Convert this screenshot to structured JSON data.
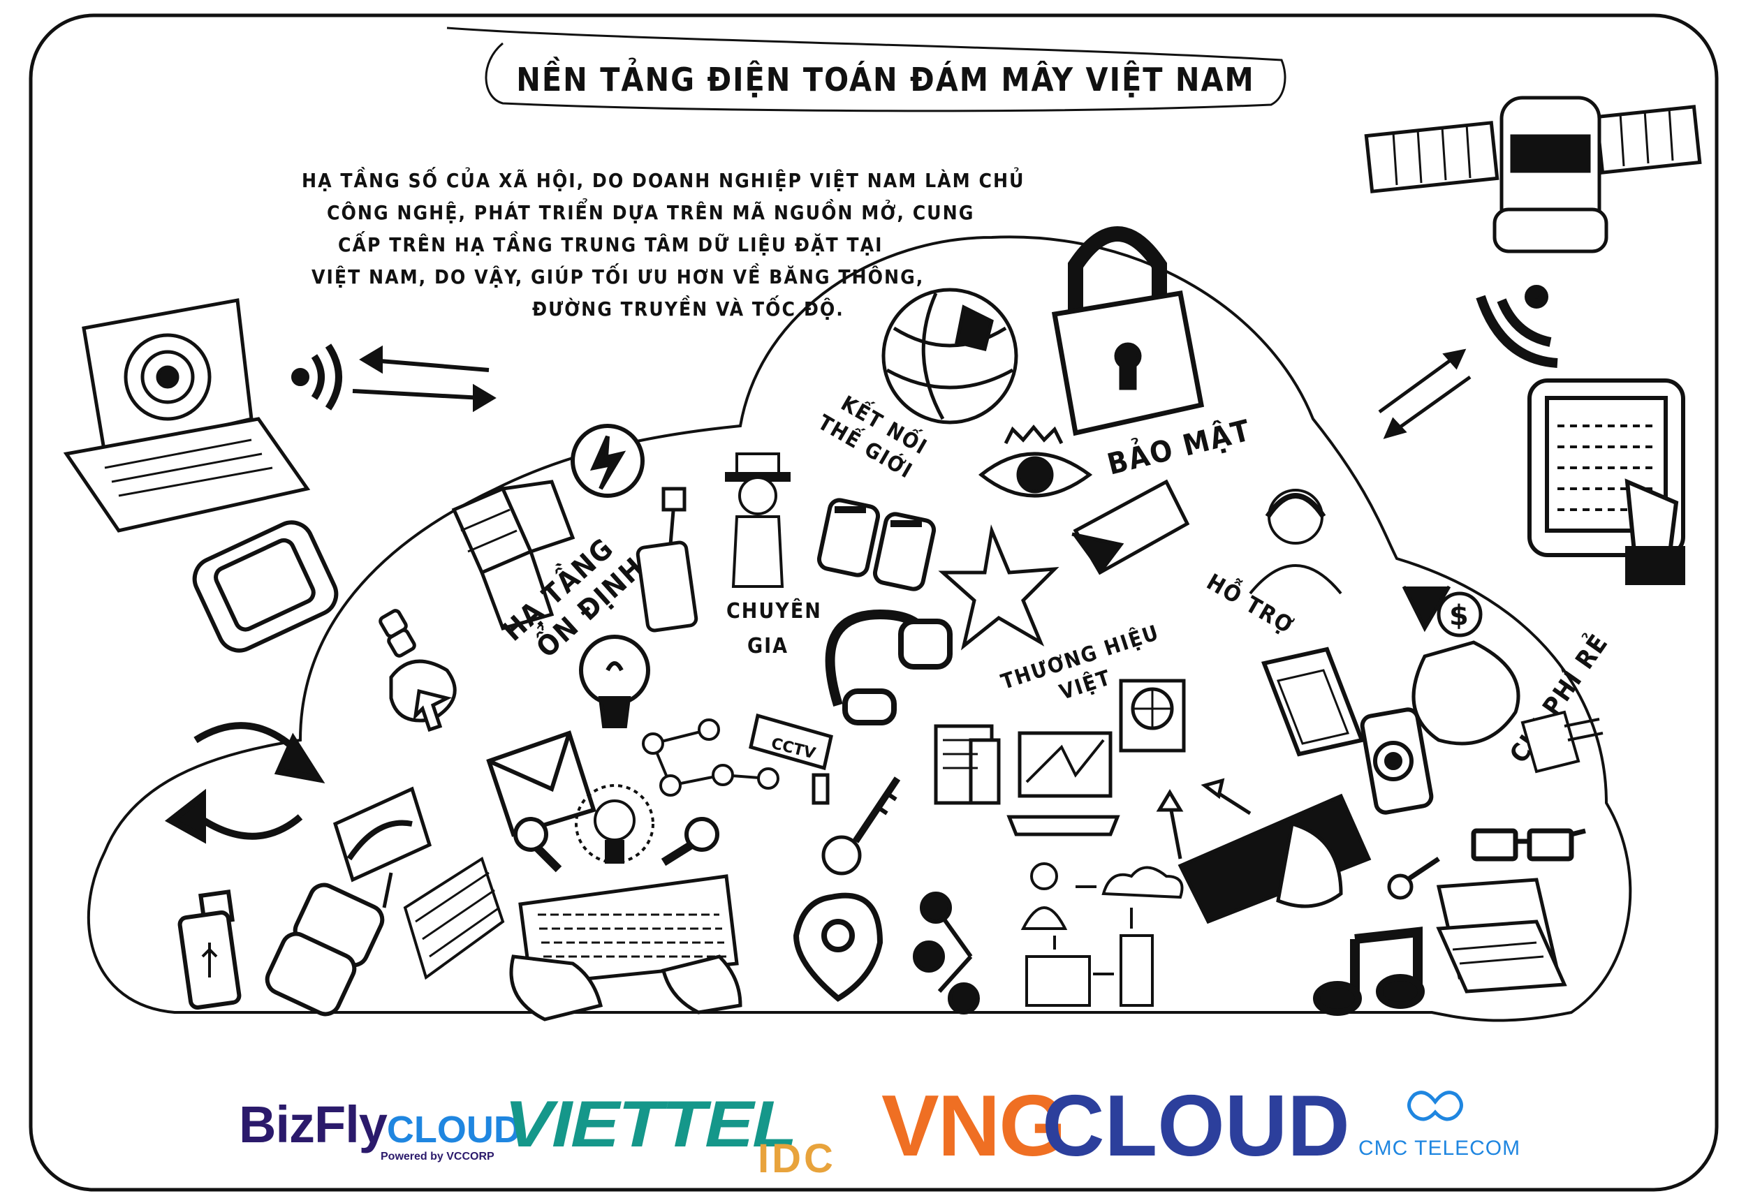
{
  "title": "NỀN TẢNG ĐIỆN TOÁN ĐÁM MÂY VIỆT NAM",
  "description_lines": [
    "HẠ TẦNG SỐ CỦA XÃ HỘI, DO DOANH NGHIỆP VIỆT NAM LÀM CHỦ",
    "CÔNG NGHỆ, PHÁT TRIỂN DỰA TRÊN MÃ NGUỒN MỞ, CUNG",
    "CẤP      TRÊN HẠ TẦNG TRUNG TÂM DỮ LIỆU ĐẶT TẠI",
    "VIỆT NAM, DO VẬY, GIÚP TỐI ƯU HƠN VỀ BĂNG THÔNG,",
    "ĐƯỜNG TRUYỀN VÀ TỐC ĐỘ."
  ],
  "labels": {
    "ket_noi": [
      "KẾT NỐI",
      "THẾ GIỚI"
    ],
    "bao_mat": "BẢO MẬT",
    "ha_tang": [
      "HẠ TẦNG",
      "ỔN ĐỊNH"
    ],
    "chuyen_gia": [
      "CHUYÊN",
      "GIA"
    ],
    "thuong_hieu": [
      "THƯƠNG HIỆU",
      "VIỆT"
    ],
    "ho_tro": "HỖ TRỢ",
    "chi_phi": "CHI PHÍ RẺ",
    "cctv": "CCTV"
  },
  "logos": {
    "bizfly_main": "BizFly",
    "bizfly_cloud": "CLOUD",
    "bizfly_sub": "Powered by VCCORP",
    "viettel": "VIETTEL",
    "viettel_idc": "IDC",
    "vng": "VNG",
    "vng_cloud": "CLOUD",
    "cmc": "CMC TELECOM"
  },
  "colors": {
    "ink": "#111111",
    "bizfly": "#2b1a6b",
    "bizfly_accent": "#1f86e0",
    "viettel": "#15978a",
    "viettel_idc": "#e8a33c",
    "vng": "#ef6f23",
    "vng_cloud": "#2c3f9c",
    "cmc": "#1f86e0"
  },
  "icons": [
    "laptop-icon",
    "wifi-icon",
    "arrows-icon",
    "satellite-icon",
    "tablet-icon",
    "globe-icon",
    "padlock-icon",
    "eye-icon",
    "star-icon",
    "server-blocks-icon",
    "lightbulb-icon",
    "usb-icon",
    "binoculars-icon",
    "headphones-icon",
    "keyboard-hands-icon",
    "envelope-icon",
    "cctv-icon",
    "key-icon",
    "location-pin-icon",
    "share-icon",
    "network-icon",
    "money-bag-icon",
    "music-note-icon",
    "glasses-icon",
    "refresh-icon",
    "computer-icon",
    "support-agent-icon",
    "printer-icon",
    "box-icon"
  ]
}
